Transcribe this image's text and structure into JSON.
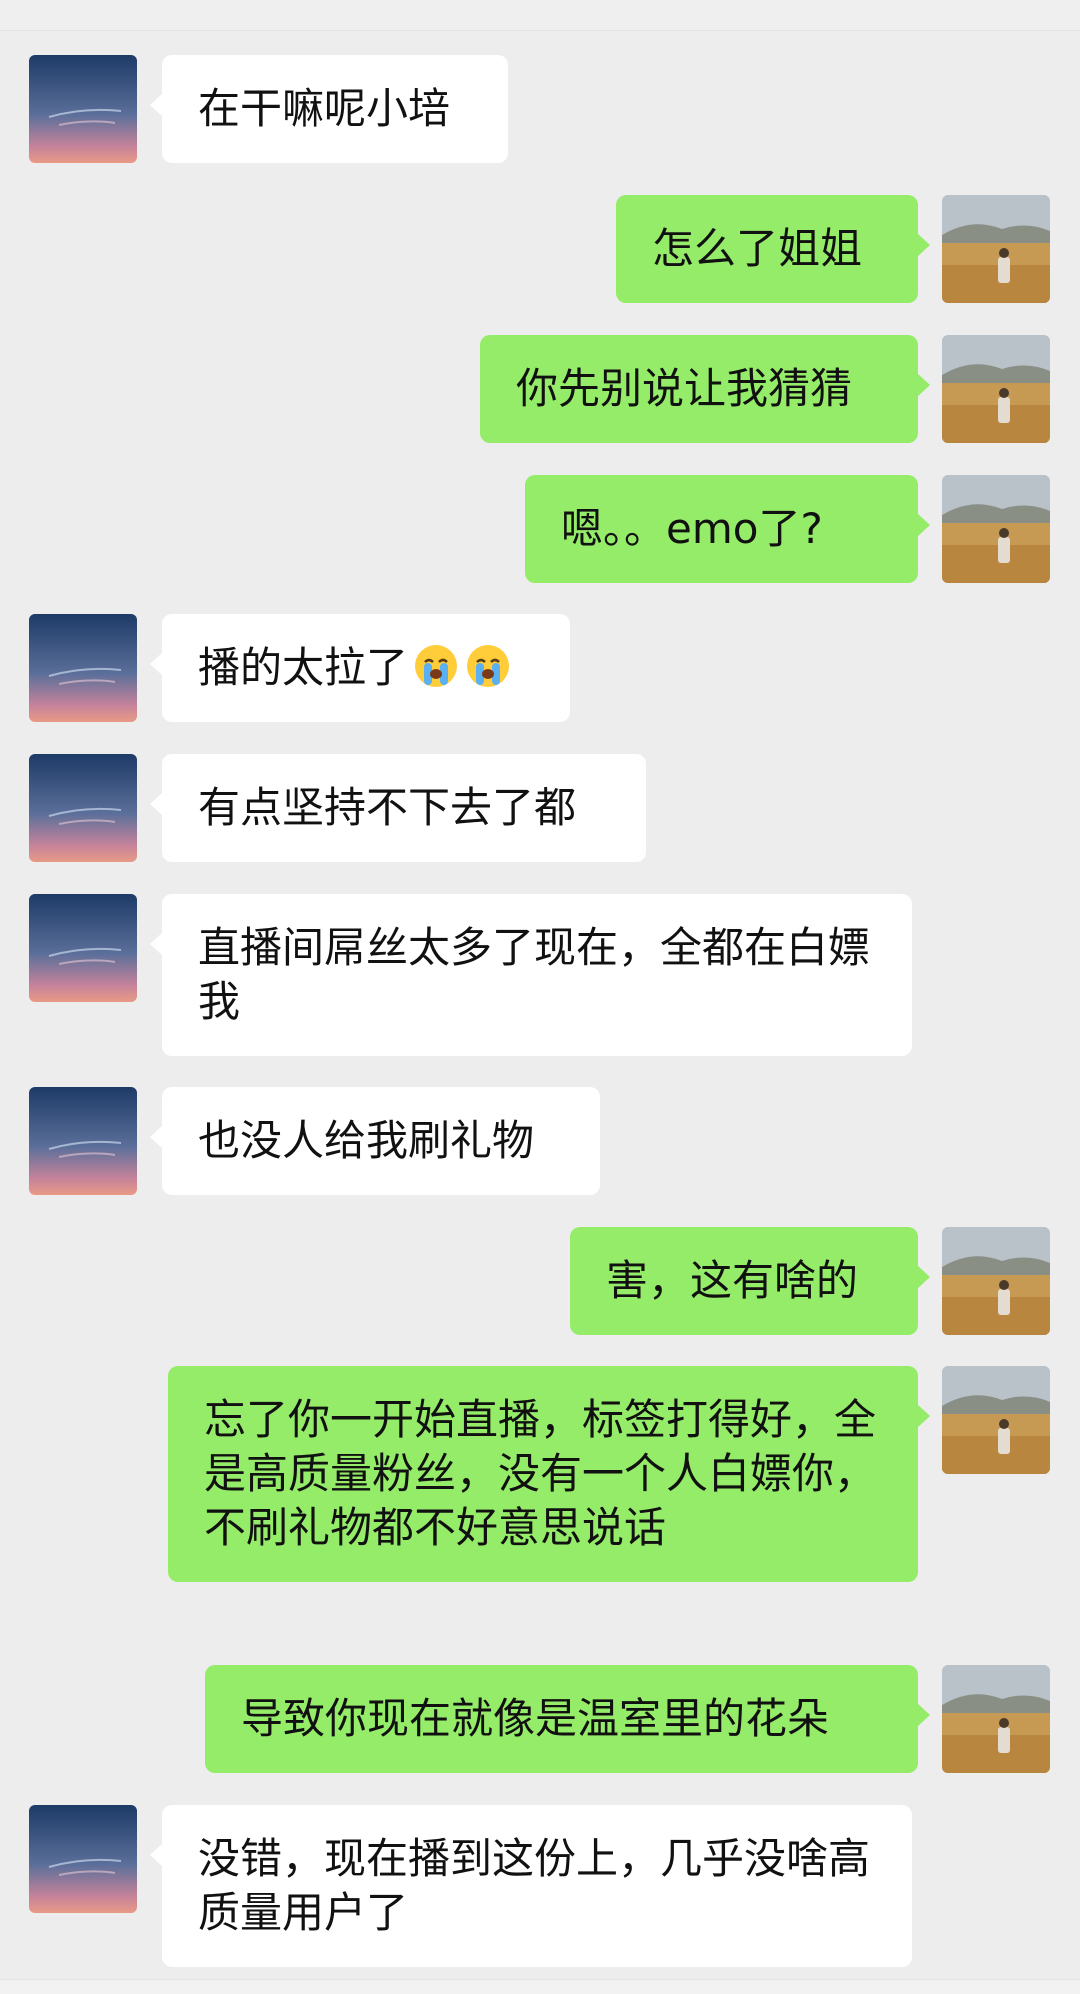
{
  "colors": {
    "background": "#ededed",
    "incoming_bubble": "#ffffff",
    "outgoing_bubble": "#95ec69",
    "text": "#111111"
  },
  "contact": {
    "avatar_icon": "sunset-sky-avatar-icon"
  },
  "me": {
    "avatar_icon": "grassland-person-avatar-icon"
  },
  "messages": [
    {
      "side": "left",
      "text": "在干嘛呢小培"
    },
    {
      "side": "right",
      "text": "怎么了姐姐"
    },
    {
      "side": "right",
      "text": "你先别说让我猜猜"
    },
    {
      "side": "right",
      "text": "嗯。。emo了?"
    },
    {
      "side": "left",
      "text": "播的太拉了",
      "emoji": [
        "crying-face-icon",
        "crying-face-icon"
      ]
    },
    {
      "side": "left",
      "text": "有点坚持不下去了都"
    },
    {
      "side": "left",
      "text": "直播间屌丝太多了现在，全都在白嫖我"
    },
    {
      "side": "left",
      "text": "也没人给我刷礼物"
    },
    {
      "side": "right",
      "text": "害，这有啥的"
    },
    {
      "side": "right",
      "text": "忘了你一开始直播，标签打得好，全是高质量粉丝，没有一个人白嫖你，不刷礼物都不好意思说话"
    },
    {
      "side": "right",
      "text": "导致你现在就像是温室里的花朵"
    },
    {
      "side": "left",
      "text": "没错，现在播到这份上，几乎没啥高质量用户了"
    }
  ]
}
